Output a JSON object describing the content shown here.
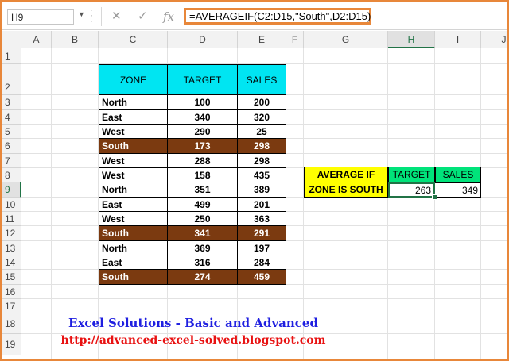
{
  "formula_bar": {
    "name_box": "H9",
    "formula": "=AVERAGEIF(C2:D15,\"South\",D2:D15)",
    "cancel_glyph": "✕",
    "enter_glyph": "✓",
    "fx_label": "fx"
  },
  "columns": [
    "A",
    "B",
    "C",
    "D",
    "E",
    "F",
    "G",
    "H",
    "I",
    "J"
  ],
  "rows": [
    "1",
    "2",
    "3",
    "4",
    "5",
    "6",
    "7",
    "8",
    "9",
    "10",
    "11",
    "12",
    "13",
    "14",
    "15",
    "16",
    "17",
    "18",
    "19"
  ],
  "table": {
    "headers": [
      "ZONE",
      "TARGET",
      "SALES"
    ],
    "rows": [
      {
        "zone": "North",
        "target": "100",
        "sales": "200",
        "south": false
      },
      {
        "zone": "East",
        "target": "340",
        "sales": "320",
        "south": false
      },
      {
        "zone": "West",
        "target": "290",
        "sales": "25",
        "south": false
      },
      {
        "zone": "South",
        "target": "173",
        "sales": "298",
        "south": true
      },
      {
        "zone": "West",
        "target": "288",
        "sales": "298",
        "south": false
      },
      {
        "zone": "West",
        "target": "158",
        "sales": "435",
        "south": false
      },
      {
        "zone": "North",
        "target": "351",
        "sales": "389",
        "south": false
      },
      {
        "zone": "East",
        "target": "499",
        "sales": "201",
        "south": false
      },
      {
        "zone": "West",
        "target": "250",
        "sales": "363",
        "south": false
      },
      {
        "zone": "South",
        "target": "341",
        "sales": "291",
        "south": true
      },
      {
        "zone": "North",
        "target": "369",
        "sales": "197",
        "south": false
      },
      {
        "zone": "East",
        "target": "316",
        "sales": "284",
        "south": false
      },
      {
        "zone": "South",
        "target": "274",
        "sales": "459",
        "south": true
      }
    ]
  },
  "summary": {
    "label_line1": "AVERAGE IF",
    "label_line2": "ZONE IS SOUTH",
    "target_header": "TARGET",
    "sales_header": "SALES",
    "target_value": "263",
    "sales_value": "349"
  },
  "footer": {
    "title": "Excel Solutions - Basic and Advanced",
    "url": "http://advanced-excel-solved.blogspot.com"
  },
  "colors": {
    "header_cyan": "#00e5f2",
    "south_brown": "#7b3a10",
    "yellow": "#ffff00",
    "green": "#00e37a",
    "frame_orange": "#e8873a",
    "excel_green": "#217346"
  }
}
